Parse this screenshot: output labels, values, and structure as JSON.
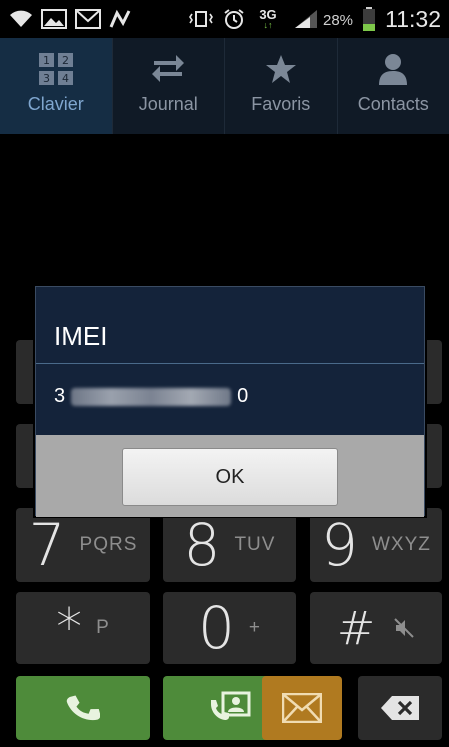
{
  "status_bar": {
    "network_type": "3G",
    "battery_percent": "28%",
    "time": "11:32"
  },
  "tabs": [
    {
      "label": "Clavier",
      "icon": "dialpad-icon",
      "active": true
    },
    {
      "label": "Journal",
      "icon": "transfer-arrows-icon",
      "active": false
    },
    {
      "label": "Favoris",
      "icon": "star-icon",
      "active": false
    },
    {
      "label": "Contacts",
      "icon": "person-icon",
      "active": false
    }
  ],
  "dialog": {
    "title": "IMEI",
    "imei_prefix": "3",
    "imei_suffix": "0",
    "ok_label": "OK"
  },
  "keypad": {
    "row3": [
      {
        "digit": "7",
        "letters": "PQRS"
      },
      {
        "digit": "8",
        "letters": "TUV"
      },
      {
        "digit": "9",
        "letters": "WXYZ"
      }
    ],
    "row4": [
      {
        "digit": "*",
        "letters": "P"
      },
      {
        "digit": "0",
        "letters": "+"
      },
      {
        "digit": "#",
        "letters": ""
      }
    ]
  },
  "action_row": {
    "call_icon": "phone-icon",
    "video_call_icon": "video-call-icon",
    "message_icon": "envelope-icon",
    "delete_icon": "backspace-icon"
  },
  "colors": {
    "tab_active_bg": "#152d44",
    "call_green": "#4e8b3a",
    "message_orange": "#b07a20",
    "dialog_bg": "#14233a"
  }
}
